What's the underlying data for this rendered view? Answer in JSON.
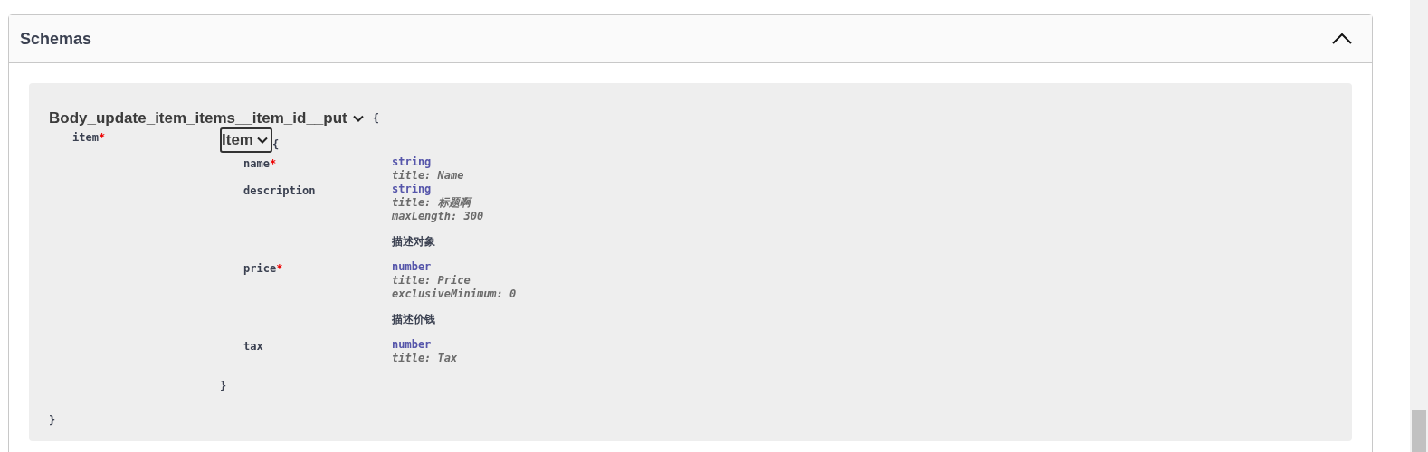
{
  "section": {
    "title": "Schemas",
    "expanded": true
  },
  "model": {
    "name": "Body_update_item_items__item_id__put",
    "expanded": true,
    "open_brace": "{",
    "close_brace": "}",
    "properties": [
      {
        "name": "item",
        "required_mark": "*",
        "model": {
          "name": "Item",
          "expanded": true,
          "open_brace": "{",
          "close_brace": "}",
          "properties": [
            {
              "name": "name",
              "required_mark": "*",
              "type": "string",
              "attributes": [
                "title: Name"
              ]
            },
            {
              "name": "description",
              "type": "string",
              "attributes": [
                "title: 标题啊",
                "maxLength: 300"
              ],
              "description": "描述对象"
            },
            {
              "name": "price",
              "required_mark": "*",
              "type": "number",
              "attributes": [
                "title: Price",
                "exclusiveMinimum: 0"
              ],
              "description": "描述价钱"
            },
            {
              "name": "tax",
              "type": "number",
              "attributes": [
                "title: Tax"
              ]
            }
          ]
        }
      }
    ]
  }
}
